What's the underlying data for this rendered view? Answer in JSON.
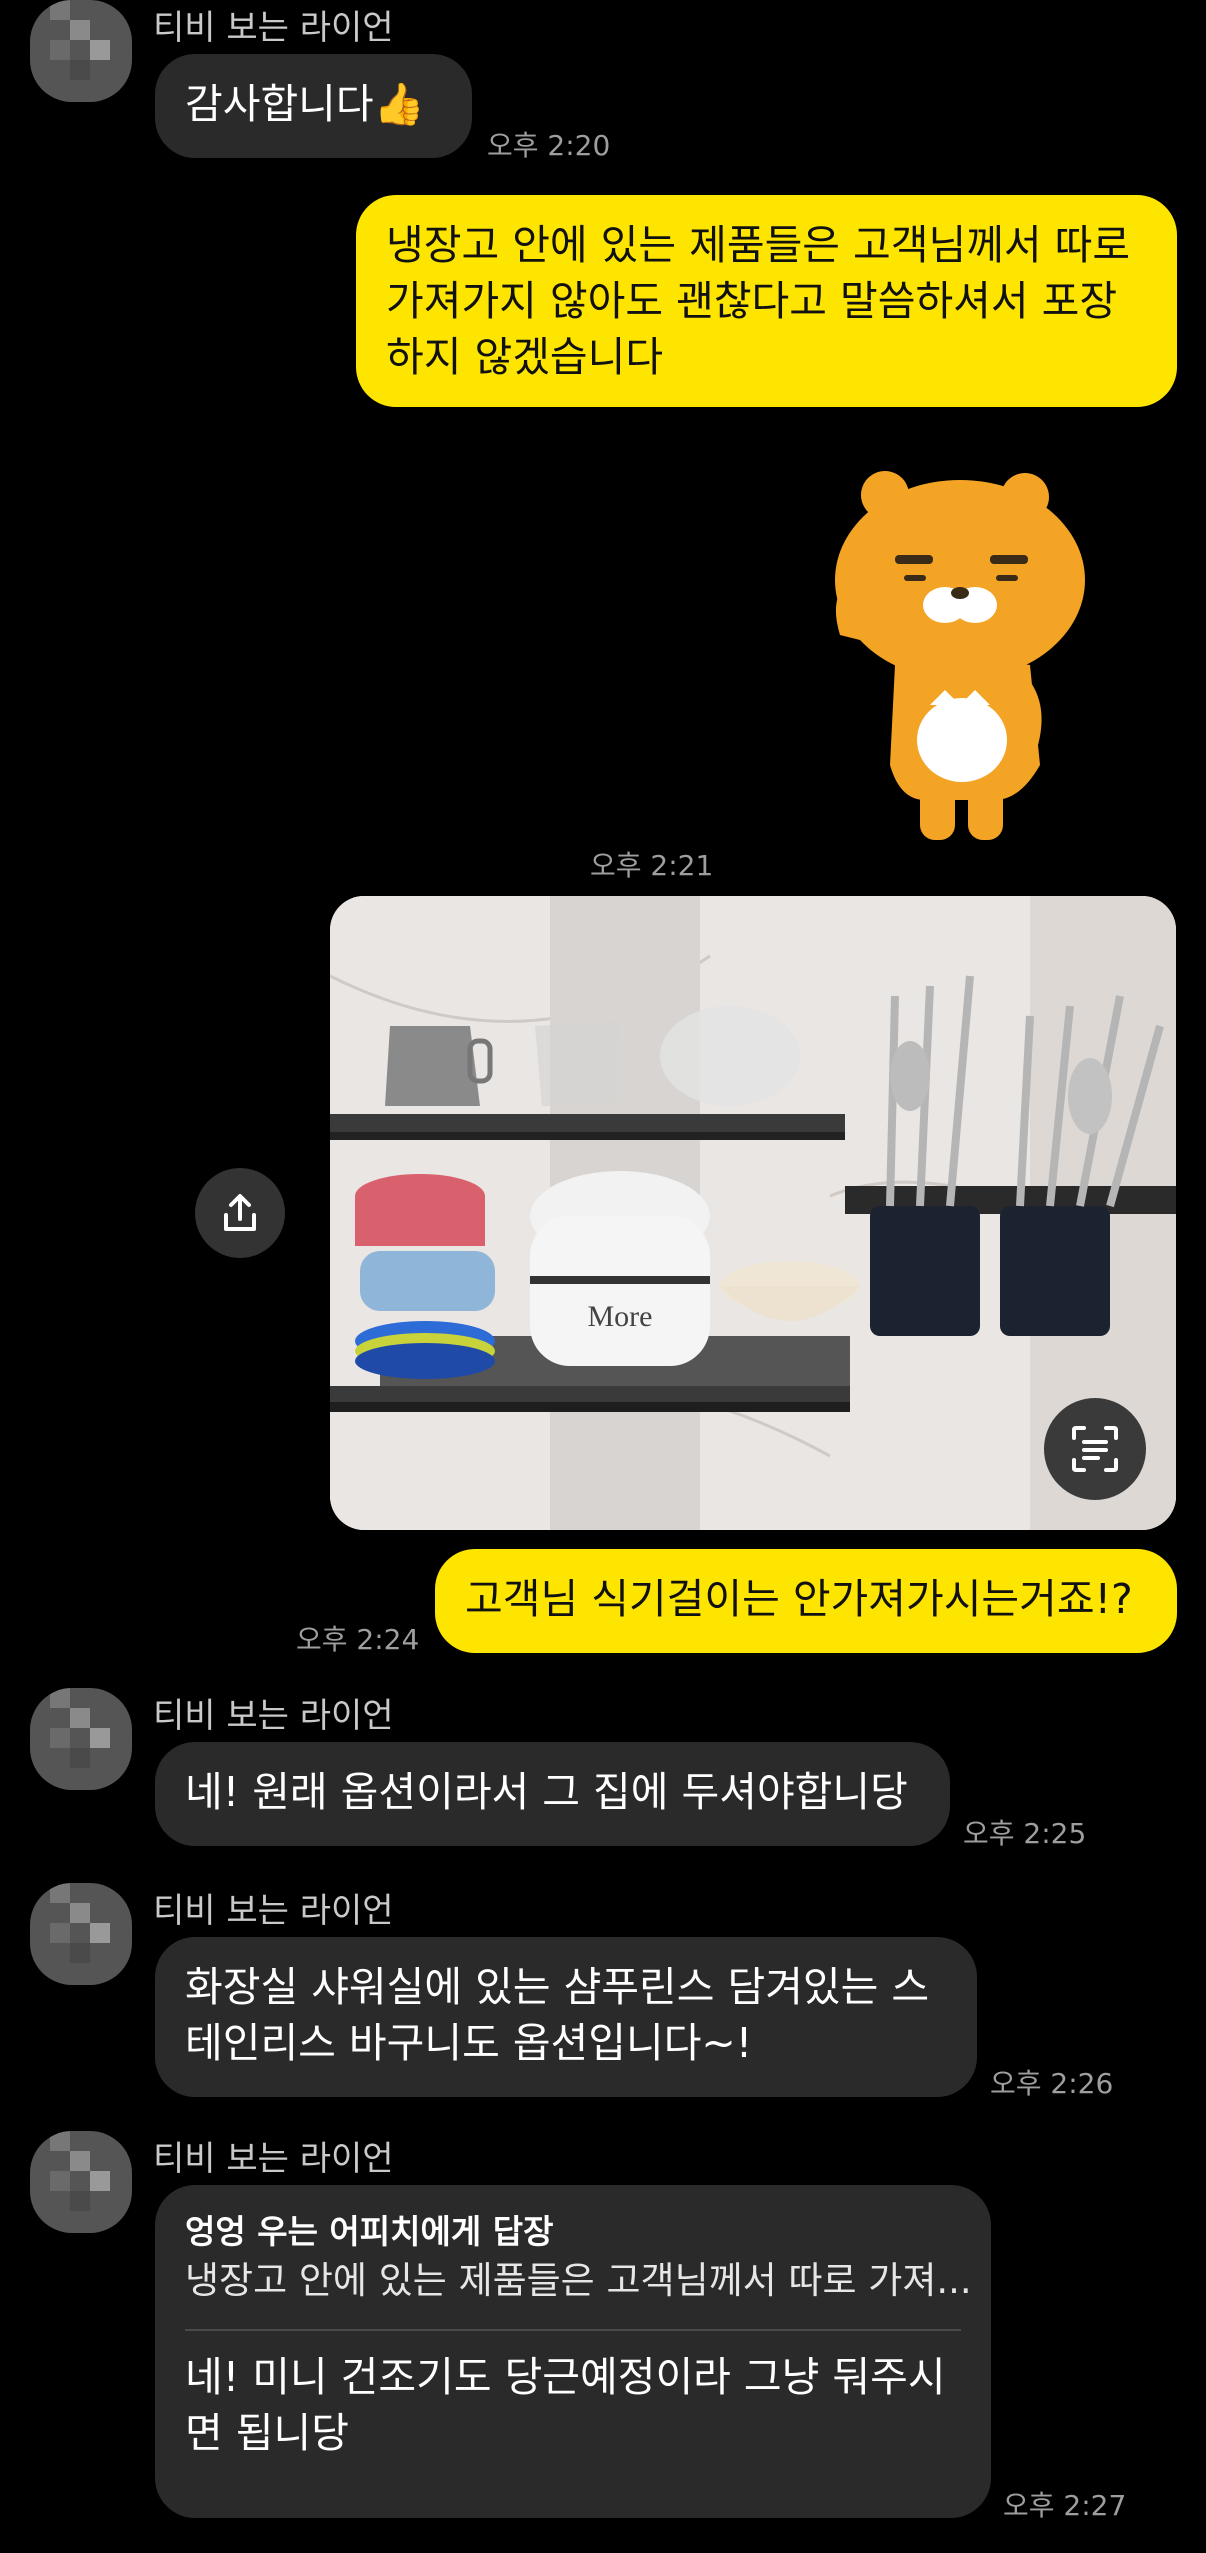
{
  "sender_name": "티비 보는 라이언",
  "messages": {
    "m1": {
      "text": "감사합니다👍",
      "time": "오후 2:20"
    },
    "m2": {
      "lines": [
        "냉장고 안에 있는 제품들은 고객님께서 따로",
        "가져가지 않아도 괜찮다고 말씀하셔서 포장",
        "하지 않겠습니다"
      ]
    },
    "sticker": {
      "description": "ryan-emoticon",
      "time": "오후 2:21"
    },
    "photo": {
      "kind": "kitchen-shelf-photo"
    },
    "m3": {
      "text": "고객님 식기걸이는 안가져가시는거죠!?",
      "time": "오후 2:24"
    },
    "m4": {
      "text": "네! 원래 옵션이라서 그 집에 두셔야합니당",
      "time": "오후 2:25"
    },
    "m5": {
      "lines": [
        "화장실 샤워실에 있는 샴푸린스 담겨있는 스",
        "테인리스 바구니도 옵션입니다~!"
      ],
      "time": "오후 2:26"
    },
    "m6": {
      "reply_to_header": "엉엉 우는 어피치에게 답장",
      "reply_quote": "냉장고 안에 있는 제품들은 고객님께서 따로 가져...",
      "lines": [
        "네! 미니 건조기도 당근예정이라 그냥 둬주시",
        "면 됩니당"
      ],
      "time": "오후 2:27"
    }
  },
  "colors": {
    "background": "#000000",
    "incoming_bubble": "#2a2a2a",
    "outgoing_bubble": "#fee500",
    "timestamp": "#9e9e9e"
  },
  "icons": [
    "share-icon",
    "text-scan-icon"
  ]
}
